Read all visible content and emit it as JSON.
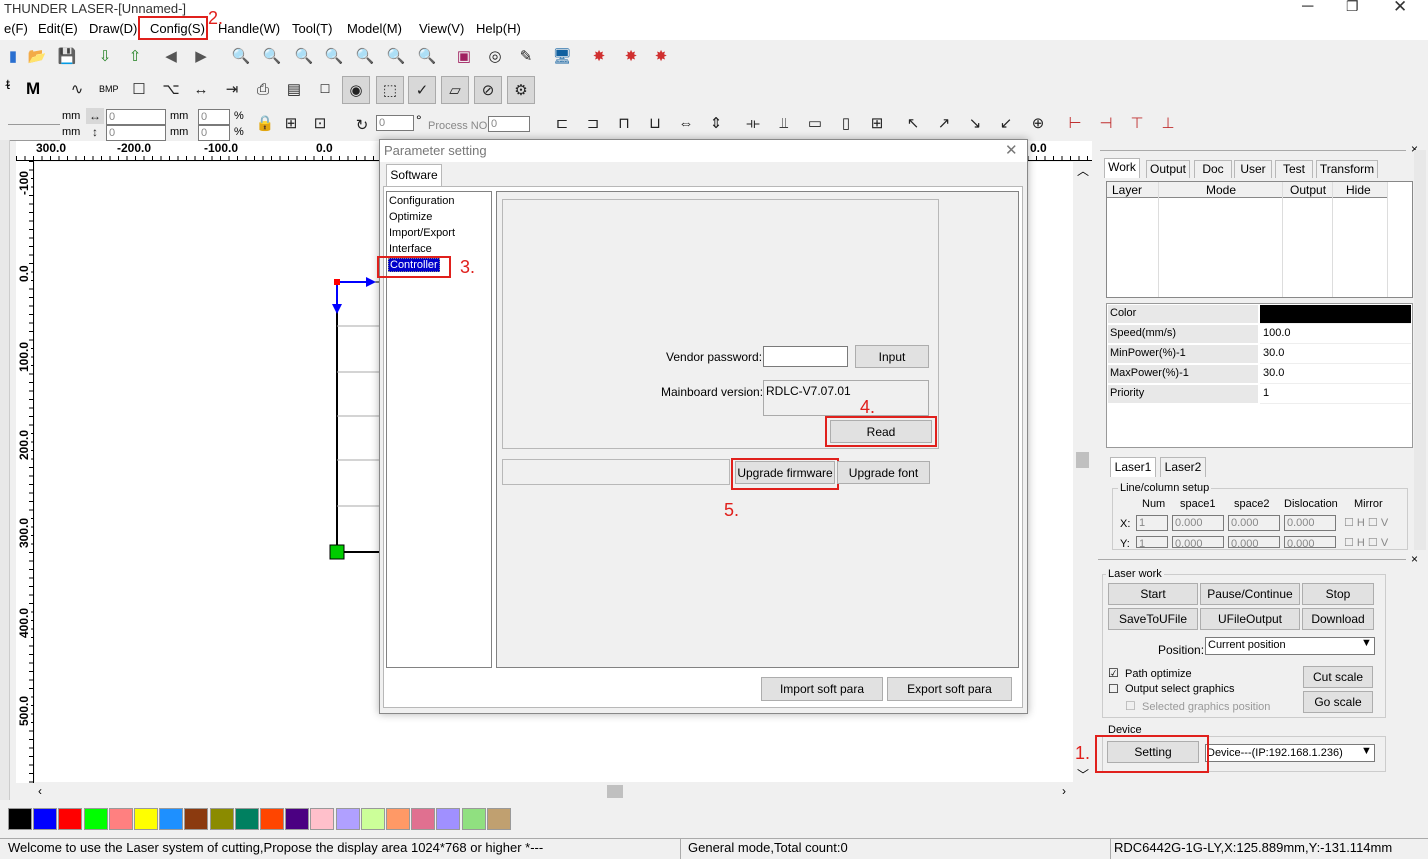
{
  "window": {
    "title": "THUNDER LASER-[Unnamed-]"
  },
  "menu": [
    "e(F)",
    "Edit(E)",
    "Draw(D)",
    "Config(S)",
    "Handle(W)",
    "Tool(T)",
    "Model(M)",
    "View(V)",
    "Help(H)"
  ],
  "toolbar2": {
    "m_label": "M",
    "bmp_label": "BMP"
  },
  "props": {
    "unit_mm": "mm",
    "unit_pct": "%",
    "zero": "0",
    "degree": "°",
    "process_no": "Process NO:"
  },
  "ruler": {
    "h": [
      "300.0",
      "-200.0",
      "-100.0",
      "0.0",
      "0.0"
    ],
    "v": [
      "-100",
      "0.0",
      "100.0",
      "200.0",
      "300.0",
      "400.0",
      "500.0"
    ]
  },
  "dialog": {
    "title": "Parameter setting",
    "tab": "Software",
    "tree": [
      "Configuration",
      "Optimize",
      "Import/Export",
      "Interface",
      "Controller"
    ],
    "vendor_label": "Vendor password:",
    "input_btn": "Input",
    "mainboard_label": "Mainboard version:",
    "mainboard_value": "RDLC-V7.07.01",
    "read_btn": "Read",
    "upgrade_fw_btn": "Upgrade firmware",
    "upgrade_font_btn": "Upgrade font",
    "import_btn": "Import soft para",
    "export_btn": "Export soft para"
  },
  "annotations": {
    "a1": "1.",
    "a2": "2.",
    "a3": "3.",
    "a4": "4.",
    "a5": "5."
  },
  "right": {
    "tabs": [
      "Work",
      "Output",
      "Doc",
      "User",
      "Test",
      "Transform"
    ],
    "layer_cols": [
      "Layer",
      "Mode",
      "Output",
      "Hide"
    ],
    "props": [
      {
        "k": "Color",
        "v": ""
      },
      {
        "k": "Speed(mm/s)",
        "v": "100.0"
      },
      {
        "k": "MinPower(%)-1",
        "v": "30.0"
      },
      {
        "k": "MaxPower(%)-1",
        "v": "30.0"
      },
      {
        "k": "Priority",
        "v": "1"
      }
    ],
    "laser_tabs": [
      "Laser1",
      "Laser2"
    ],
    "linecol": {
      "title": "Line/column setup",
      "cols": [
        "Num",
        "space1",
        "space2",
        "Dislocation",
        "Mirror"
      ],
      "x_label": "X:",
      "y_label": "Y:",
      "num": "1",
      "val": "0.000",
      "h": "H",
      "v": "V"
    },
    "laserwork": {
      "title": "Laser work",
      "start": "Start",
      "pause": "Pause/Continue",
      "stop": "Stop",
      "save": "SaveToUFile",
      "ufile": "UFileOutput",
      "download": "Download",
      "position_label": "Position:",
      "position_value": "Current position",
      "path_opt": "Path optimize",
      "output_sel": "Output select graphics",
      "sel_pos": "Selected graphics position",
      "cut_scale": "Cut scale",
      "go_scale": "Go scale"
    },
    "device": {
      "title": "Device",
      "setting": "Setting",
      "value": "Device---(IP:192.168.1.236)"
    }
  },
  "palette": [
    "#000000",
    "#0000ff",
    "#ff0000",
    "#00ff00",
    "#ff8080",
    "#ffff00",
    "#1e90ff",
    "#8b3a0f",
    "#8b8b00",
    "#008060",
    "#ff4500",
    "#4b0082",
    "#ffc0cb",
    "#b0a0ff",
    "#ccff99",
    "#ff9966",
    "#e07090",
    "#a090ff",
    "#90e080",
    "#c0a070"
  ],
  "status": {
    "left": "Welcome to use the Laser system of cutting,Propose the display area 1024*768 or higher *---",
    "mid": "General mode,Total count:0",
    "right": "RDC6442G-1G-LY,X:125.889mm,Y:-131.114mm"
  }
}
